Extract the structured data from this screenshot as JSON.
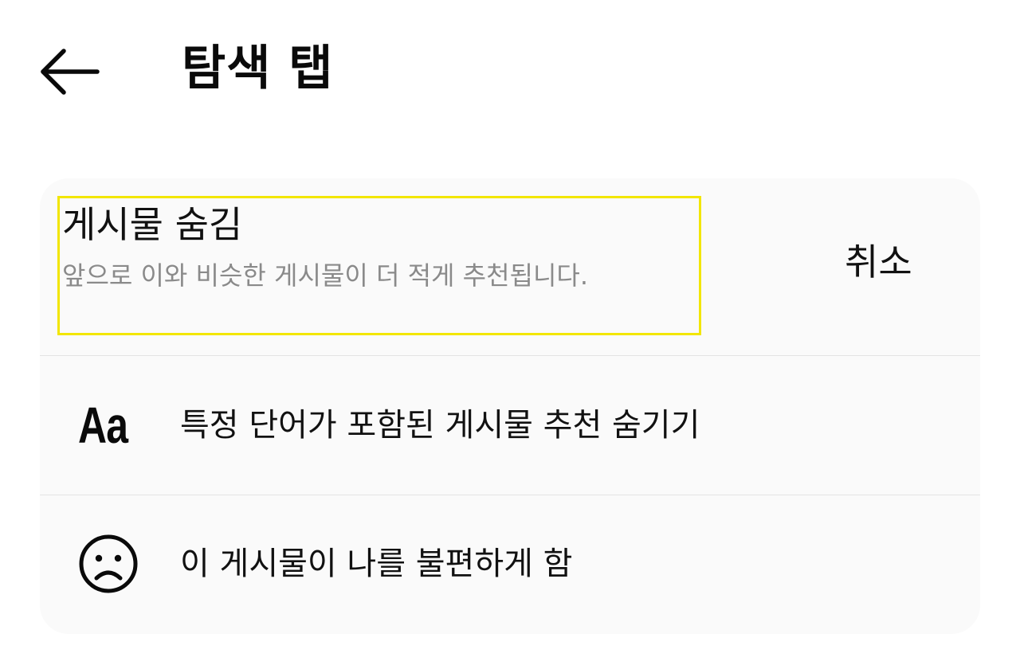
{
  "header": {
    "back_icon": "arrow-left-icon",
    "title": "탐색 탭"
  },
  "notice": {
    "title": "게시물 숨김",
    "subtitle": "앞으로 이와 비슷한 게시물이 더 적게 추천됩니다.",
    "undo_label": "취소",
    "highlight_color": "#f2e600"
  },
  "options": [
    {
      "icon": "text-aa-icon",
      "icon_glyph": "Aa",
      "label": "특정 단어가 포함된 게시물 추천 숨기기"
    },
    {
      "icon": "sad-face-icon",
      "label": "이 게시물이 나를 불편하게 함"
    }
  ],
  "colors": {
    "card_background": "#fafafa",
    "subtitle_text": "#8a8a8a",
    "divider": "#e3e3e3"
  }
}
